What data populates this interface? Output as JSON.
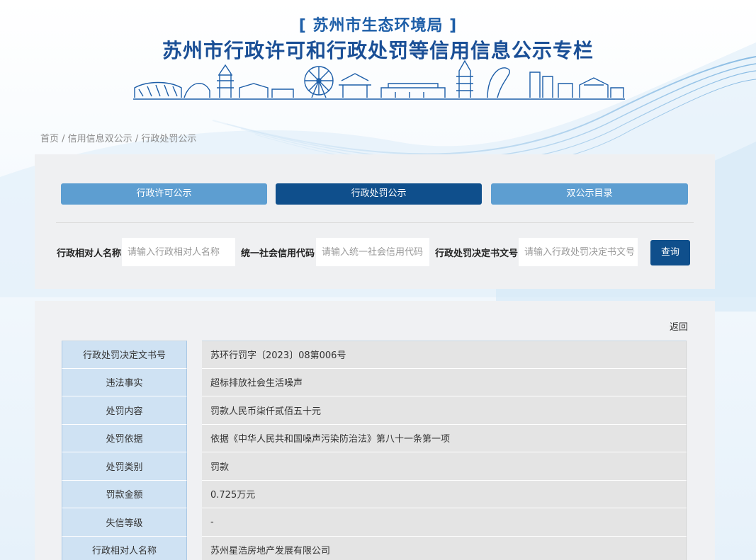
{
  "header": {
    "department": "[ 苏州市生态环境局 ]",
    "title": "苏州市行政许可和行政处罚等信用信息公示专栏"
  },
  "breadcrumb": [
    {
      "label": "首页"
    },
    {
      "label": "信用信息双公示"
    },
    {
      "label": "行政处罚公示"
    }
  ],
  "breadcrumb_separator": " / ",
  "tabs": [
    {
      "label": "行政许可公示",
      "active": false
    },
    {
      "label": "行政处罚公示",
      "active": true
    },
    {
      "label": "双公示目录",
      "active": false
    }
  ],
  "search": {
    "name_label": "行政相对人名称",
    "name_placeholder": "请输入行政相对人名称",
    "credit_code_label": "统一社会信用代码",
    "credit_code_placeholder": "请输入统一社会信用代码",
    "decision_no_label": "行政处罚决定书文号",
    "decision_no_placeholder": "请输入行政处罚决定书文号",
    "query_label": "查询"
  },
  "detail": {
    "back_label": "返回",
    "rows": [
      {
        "key": "行政处罚决定文书号",
        "value": "苏环行罚字〔2023〕08第006号"
      },
      {
        "key": "违法事实",
        "value": "超标排放社会生活噪声"
      },
      {
        "key": "处罚内容",
        "value": "罚款人民币柒仟贰佰五十元"
      },
      {
        "key": "处罚依据",
        "value": "依据《中华人民共和国噪声污染防治法》第八十一条第一项"
      },
      {
        "key": "处罚类别",
        "value": "罚款"
      },
      {
        "key": "罚款金额",
        "value": "0.725万元"
      },
      {
        "key": "失信等级",
        "value": "-"
      },
      {
        "key": "行政相对人名称",
        "value": "苏州星浩房地产发展有限公司"
      }
    ]
  },
  "colors": {
    "brand_dark": "#0f4f8c",
    "tab_light": "#5d9ed1",
    "title_blue": "#1a4f96",
    "key_cell": "#cfe2f3",
    "value_cell": "#e4e4e4"
  }
}
